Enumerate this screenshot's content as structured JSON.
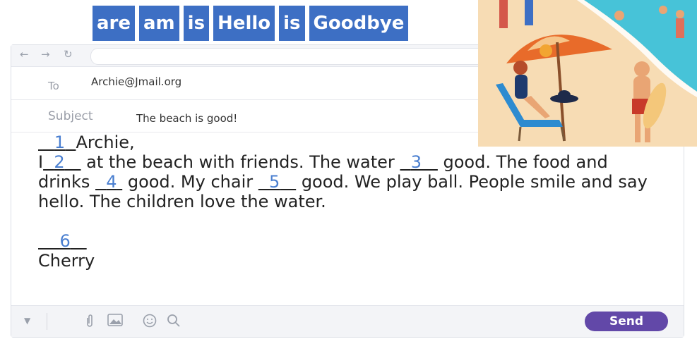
{
  "word_bank": [
    "are",
    "am",
    "is",
    "Hello",
    "is",
    "Goodbye"
  ],
  "email": {
    "to_label": "To",
    "to_value": "Archie@Jmail.org",
    "subject_label": "Subject",
    "subject_value": "The beach is good!",
    "send_label": "Send"
  },
  "letter": {
    "line1": {
      "b1": "1",
      "rest": "Archie,"
    },
    "para": {
      "start": "I",
      "b2": "2",
      "mid1": " at the beach with friends. The water ",
      "b3": "3",
      "mid2": " good. The food and drinks ",
      "b4": "4",
      "mid3": " good. My chair ",
      "b5": "5",
      "end": " good. We play ball. People smile and say hello. The children love the water."
    },
    "b6": "6",
    "signature": "Cherry"
  },
  "colors": {
    "word_box": "#3d6fc4",
    "send_button": "#6248a8",
    "blank_number": "#4a7fd0"
  }
}
